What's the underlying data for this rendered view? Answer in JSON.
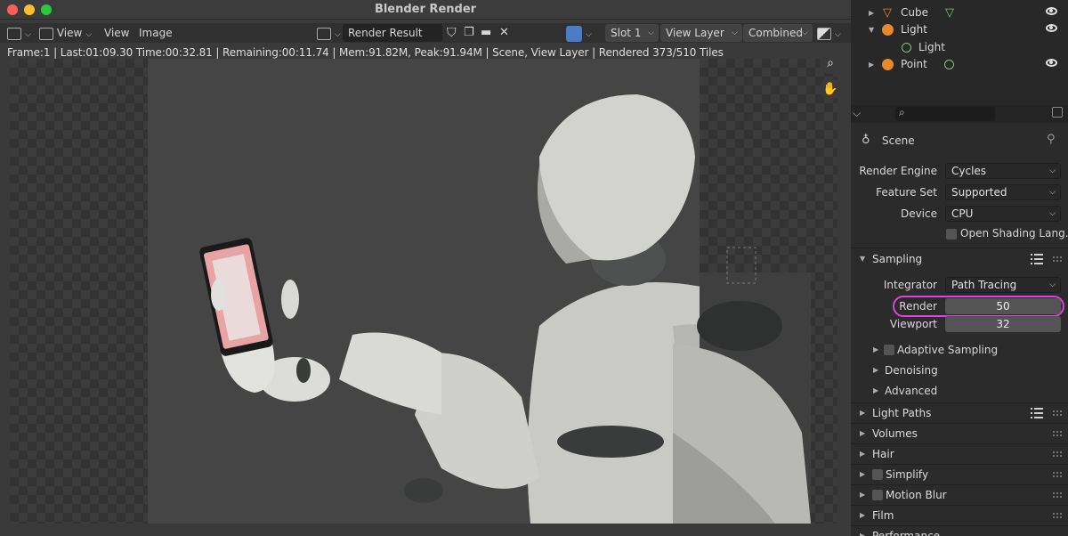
{
  "window": {
    "title": "Blender Render",
    "traffic_colors": [
      "#fe5f57",
      "#febc2e",
      "#28c840"
    ]
  },
  "toolbar": {
    "menu_view_dropdown": "View",
    "menu_view": "View",
    "menu_image": "Image",
    "image_name": "Render Result",
    "slot": "Slot 1",
    "view_layer": "View Layer",
    "pass": "Combined"
  },
  "status_text": "Frame:1 | Last:01:09.30 Time:00:32.81 | Remaining:00:11.74 | Mem:91.82M, Peak:91.94M | Scene, View Layer | Rendered 373/510 Tiles",
  "outliner": {
    "items": [
      {
        "label": "Cube",
        "icon": "cube-icon",
        "data_icon": "mesh-data-icon",
        "color": "#e8882a"
      },
      {
        "label": "Light",
        "icon": "light-icon",
        "data_icon": "",
        "color": "#e8882a"
      },
      {
        "label": "Light",
        "icon": "light-data-icon",
        "data_icon": "",
        "color": "#7fc47f"
      },
      {
        "label": "Point",
        "icon": "point-light-icon",
        "data_icon": "light-data-icon",
        "color": "#e8882a"
      }
    ]
  },
  "properties": {
    "context": "Scene",
    "render_engine_label": "Render Engine",
    "render_engine": "Cycles",
    "feature_set_label": "Feature Set",
    "feature_set": "Supported",
    "device_label": "Device",
    "device": "CPU",
    "open_shading_label": "Open Shading Lang...",
    "sampling": {
      "title": "Sampling",
      "integrator_label": "Integrator",
      "integrator": "Path Tracing",
      "render_label": "Render",
      "render_samples": "50",
      "viewport_label": "Viewport",
      "viewport_samples": "32",
      "subpanels": [
        "Adaptive Sampling",
        "Denoising",
        "Advanced"
      ]
    },
    "panels": [
      "Light Paths",
      "Volumes",
      "Hair",
      "Simplify",
      "Motion Blur",
      "Film",
      "Performance"
    ],
    "highlight_color": "#e040e0"
  }
}
